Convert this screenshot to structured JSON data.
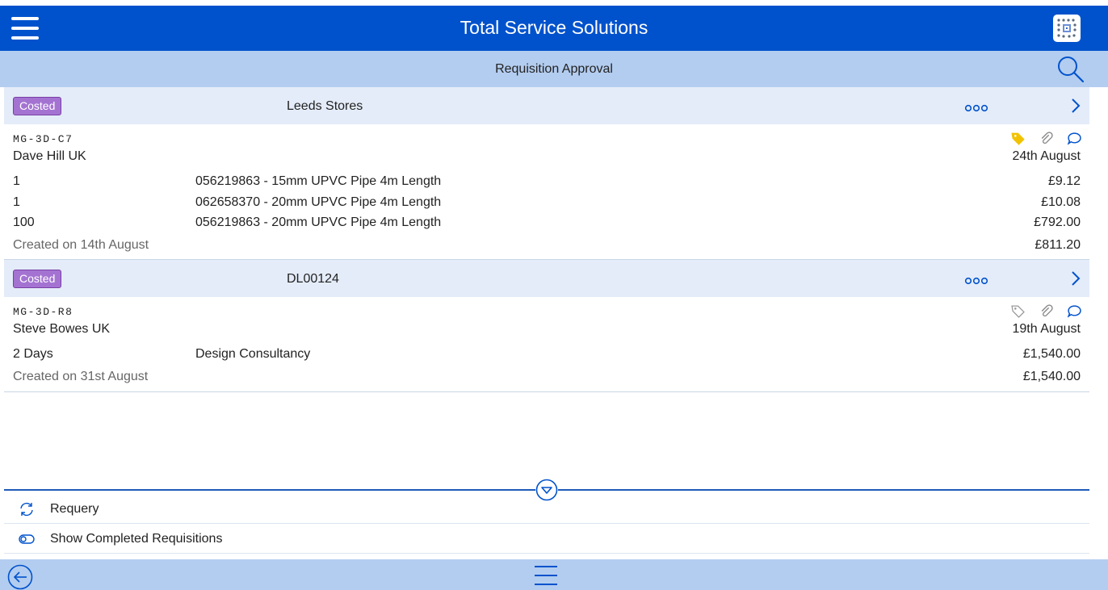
{
  "header": {
    "title": "Total Service Solutions",
    "menu_icon": "hamburger-icon",
    "app_icon": "app-grid-logo-icon"
  },
  "subheader": {
    "title": "Requisition Approval",
    "search_icon": "search-icon"
  },
  "requisitions": [
    {
      "status": "Costed",
      "name": "Leeds Stores",
      "code": "MG-3D-C7",
      "person": "Dave Hill UK",
      "date": "24th August",
      "tag_active": true,
      "lines": [
        {
          "qty": "1",
          "desc": "056219863 - 15mm UPVC Pipe 4m Length",
          "price": "£9.12"
        },
        {
          "qty": "1",
          "desc": "062658370 - 20mm UPVC Pipe 4m Length",
          "price": "£10.08"
        },
        {
          "qty": "100",
          "desc": "056219863 - 20mm UPVC Pipe 4m Length",
          "price": "£792.00"
        }
      ],
      "created": "Created on 14th August",
      "total": "£811.20"
    },
    {
      "status": "Costed",
      "name": "DL00124",
      "code": "MG-3D-R8",
      "person": "Steve Bowes UK",
      "date": "19th August",
      "tag_active": false,
      "lines": [
        {
          "qty": "2 Days",
          "desc": "Design Consultancy",
          "price": "£1,540.00"
        }
      ],
      "created": "Created on 31st August",
      "total": "£1,540.00"
    }
  ],
  "options": {
    "requery_label": "Requery",
    "show_completed_label": "Show Completed Requisitions"
  },
  "colors": {
    "primary": "#0052cc",
    "light_bar": "#b3cdf0",
    "header_row": "#e4ecf9",
    "badge": "#a473d2",
    "tag_active": "#f2c200"
  }
}
